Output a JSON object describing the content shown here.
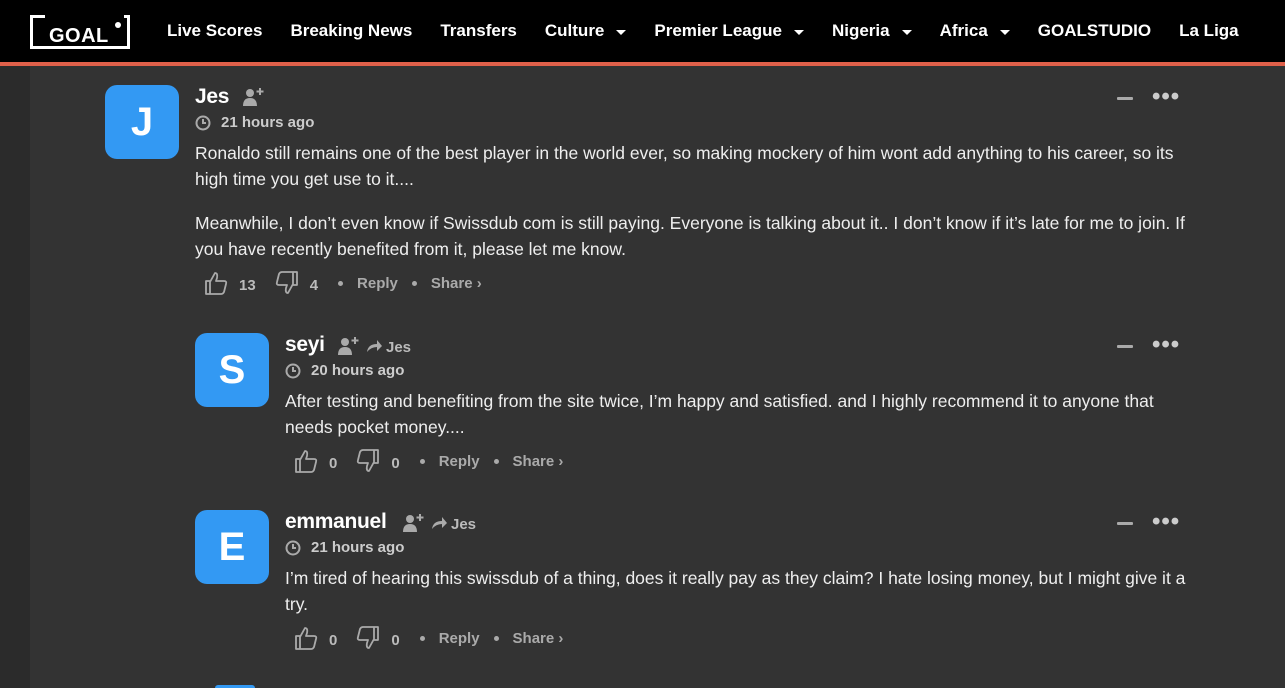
{
  "nav": {
    "logo": "GOAL",
    "items": [
      {
        "label": "Live Scores",
        "dropdown": false
      },
      {
        "label": "Breaking News",
        "dropdown": false
      },
      {
        "label": "Transfers",
        "dropdown": false
      },
      {
        "label": "Culture",
        "dropdown": true
      },
      {
        "label": "Premier League",
        "dropdown": true
      },
      {
        "label": "Nigeria",
        "dropdown": true
      },
      {
        "label": "Africa",
        "dropdown": true
      },
      {
        "label": "GOALSTUDIO",
        "dropdown": false
      },
      {
        "label": "La Liga",
        "dropdown": false
      }
    ],
    "accent_color": "#e0604a"
  },
  "comments": [
    {
      "initial": "J",
      "author": "Jes",
      "reply_to": "",
      "time": "21 hours ago",
      "paragraphs": [
        "Ronaldo still remains one of the best player in the world ever, so making mockery of him wont add anything to his career, so its high time you get use to it....",
        "Meanwhile, I don’t even know if Swissdub com is still paying. Everyone is talking about it.. I don’t know if it’s late for me to join. If you have recently benefited from it, please let me know."
      ],
      "upvotes": "13",
      "downvotes": "4",
      "reply_label": "Reply",
      "share_label": "Share ›"
    },
    {
      "initial": "S",
      "author": "seyi",
      "reply_to": "Jes",
      "time": "20 hours ago",
      "paragraphs": [
        "After testing and benefiting from the site twice, I’m happy and satisfied. and I highly recommend it to anyone that needs pocket money...."
      ],
      "upvotes": "0",
      "downvotes": "0",
      "reply_label": "Reply",
      "share_label": "Share ›"
    },
    {
      "initial": "E",
      "author": "emmanuel",
      "reply_to": "Jes",
      "time": "21 hours ago",
      "paragraphs": [
        "I’m tired of hearing this swissdub of a thing, does it really pay as they claim? I hate losing money, but I might give it a try."
      ],
      "upvotes": "0",
      "downvotes": "0",
      "reply_label": "Reply",
      "share_label": "Share ›"
    }
  ],
  "colors": {
    "avatar": "#3399f3",
    "background": "#2b2b2b",
    "panel": "#333333"
  }
}
